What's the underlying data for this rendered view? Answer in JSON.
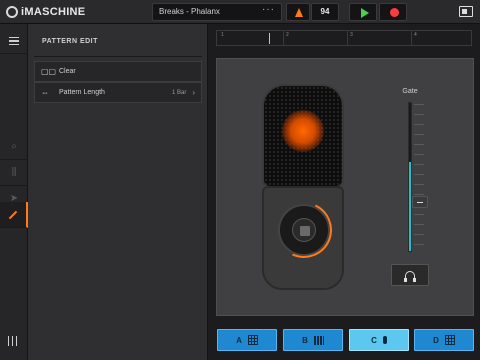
{
  "app": {
    "logo_text": "iMASCHINE"
  },
  "transport": {
    "project_name": "Breaks - Phalanx",
    "more_label": "···",
    "tempo": "94",
    "play_icon": "play-icon",
    "record_icon": "record-icon",
    "metronome_icon": "metronome-icon",
    "accent_color": "#ff7a1a"
  },
  "panel": {
    "title": "PATTERN EDIT",
    "rows": [
      {
        "icon": "clear-icon",
        "icon_glyph": "▢▢",
        "label": "Clear",
        "value": ""
      },
      {
        "icon": "length-arrows-icon",
        "icon_glyph": "⇔",
        "label": "Pattern Length",
        "value": "1 Bar",
        "chevron": "›"
      }
    ]
  },
  "timeline": {
    "markers": [
      "1",
      "2",
      "3",
      "4"
    ]
  },
  "recorder": {
    "gate_label": "Gate",
    "gate_level": 0.6,
    "headphone_icon": "headphone-icon"
  },
  "groups": [
    {
      "label": "A",
      "icon": "pad-grid-icon",
      "selected": false
    },
    {
      "label": "B",
      "icon": "keyboard-icon",
      "selected": false
    },
    {
      "label": "C",
      "icon": "microphone-icon",
      "selected": true
    },
    {
      "label": "D",
      "icon": "pad-grid-icon",
      "selected": false
    }
  ]
}
